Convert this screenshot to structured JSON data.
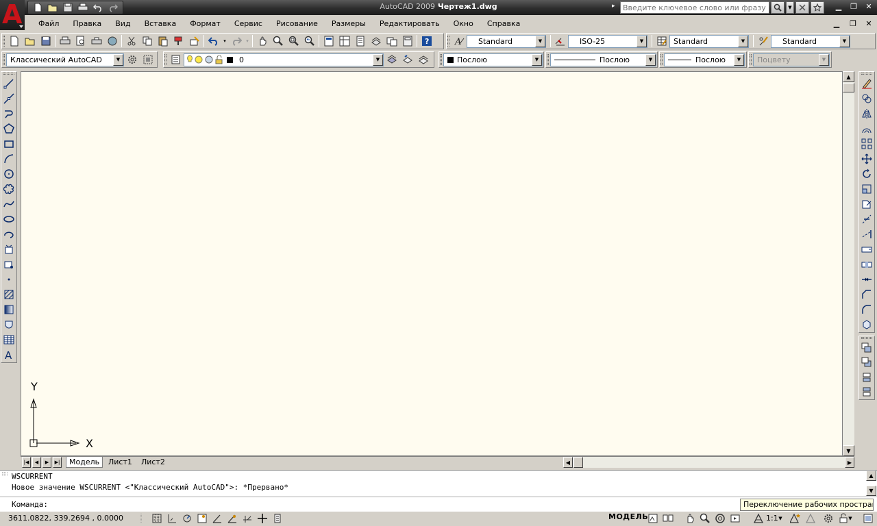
{
  "app": {
    "title_app": "AutoCAD 2009",
    "title_doc": "Чертеж1.dwg",
    "search_placeholder": "Введите ключевое слово или фразу"
  },
  "menu": [
    "Файл",
    "Правка",
    "Вид",
    "Вставка",
    "Формат",
    "Сервис",
    "Рисование",
    "Размеры",
    "Редактировать",
    "Окно",
    "Справка"
  ],
  "styles_toolbar": {
    "text_style": "Standard",
    "dim_style": "ISO-25",
    "table_style": "Standard",
    "mleader_style": "Standard"
  },
  "workspace": {
    "current": "Классический AutoCAD"
  },
  "layers": {
    "current_layer": "0"
  },
  "properties": {
    "color": "Послою",
    "linetype": "Послою",
    "lineweight": "Послою",
    "plotstyle": "Поцвету"
  },
  "ucs": {
    "x_label": "X",
    "y_label": "Y"
  },
  "layout_tabs": [
    "Модель",
    "Лист1",
    "Лист2"
  ],
  "command": {
    "history": [
      "WSCURRENT",
      "Новое значение WSCURRENT <\"Классический AutoCAD\">: *Прервано*"
    ],
    "prompt": "Команда:"
  },
  "tooltip": "Переключение рабочих пространств",
  "status": {
    "coordinates": "3611.0822, 339.2694 , 0.0000",
    "model_label": "МОДЕЛЬ",
    "annotation_scale": "1:1"
  },
  "colors": {
    "canvas_bg": "#fffcf0",
    "titlebar": "#2e2e2e",
    "logo_red": "#c8141a",
    "ui_gray": "#d4d0c8"
  }
}
